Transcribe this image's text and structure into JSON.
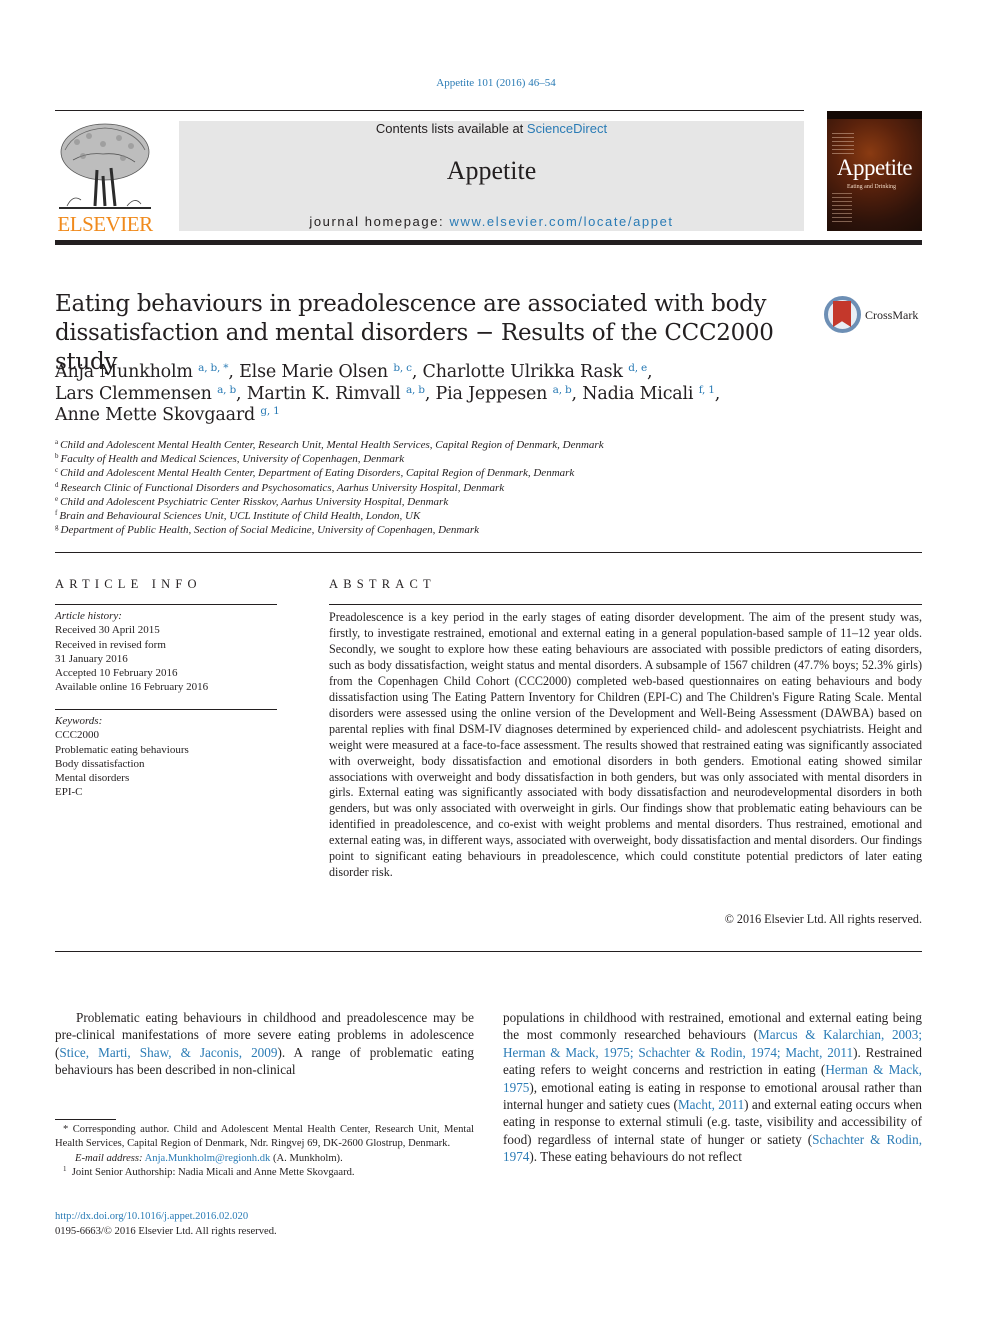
{
  "header": {
    "citation": "Appetite 101 (2016) 46–54",
    "contents_prefix": "Contents lists available at ",
    "contents_link": "ScienceDirect",
    "journal_name": "Appetite",
    "homepage_prefix": "journal homepage: ",
    "homepage_link": "www.elsevier.com/locate/appet",
    "publisher_logo_text": "ELSEVIER",
    "cover_title": "Appetite",
    "cover_subtitle": "Eating and Drinking",
    "crossmark_label": "CrossMark"
  },
  "article": {
    "title": "Eating behaviours in preadolescence are associated with body dissatisfaction and mental disorders − Results of the CCC2000 study",
    "authors": [
      {
        "name": "Anja Munkholm",
        "sup": "a, b, *",
        "sep": ", "
      },
      {
        "name": "Else Marie Olsen",
        "sup": "b, c",
        "sep": ", "
      },
      {
        "name": "Charlotte Ulrikka Rask",
        "sup": "d, e",
        "sep": ","
      },
      {
        "name": "Lars Clemmensen",
        "sup": "a, b",
        "sep": ", "
      },
      {
        "name": "Martin K. Rimvall",
        "sup": "a, b",
        "sep": ", "
      },
      {
        "name": "Pia Jeppesen",
        "sup": "a, b",
        "sep": ", "
      },
      {
        "name": "Nadia Micali",
        "sup": "f, 1",
        "sep": ","
      },
      {
        "name": "Anne Mette Skovgaard",
        "sup": "g, 1",
        "sep": ""
      }
    ],
    "affiliations": [
      {
        "key": "a",
        "text": "Child and Adolescent Mental Health Center, Research Unit, Mental Health Services, Capital Region of Denmark, Denmark"
      },
      {
        "key": "b",
        "text": "Faculty of Health and Medical Sciences, University of Copenhagen, Denmark"
      },
      {
        "key": "c",
        "text": "Child and Adolescent Mental Health Center, Department of Eating Disorders, Capital Region of Denmark, Denmark"
      },
      {
        "key": "d",
        "text": "Research Clinic of Functional Disorders and Psychosomatics, Aarhus University Hospital, Denmark"
      },
      {
        "key": "e",
        "text": "Child and Adolescent Psychiatric Center Risskov, Aarhus University Hospital, Denmark"
      },
      {
        "key": "f",
        "text": "Brain and Behavioural Sciences Unit, UCL Institute of Child Health, London, UK"
      },
      {
        "key": "g",
        "text": "Department of Public Health, Section of Social Medicine, University of Copenhagen, Denmark"
      }
    ]
  },
  "article_info": {
    "heading": "ARTICLE INFO",
    "history_label": "Article history:",
    "history": [
      "Received 30 April 2015",
      "Received in revised form",
      "31 January 2016",
      "Accepted 10 February 2016",
      "Available online 16 February 2016"
    ],
    "keywords_label": "Keywords:",
    "keywords": [
      "CCC2000",
      "Problematic eating behaviours",
      "Body dissatisfaction",
      "Mental disorders",
      "EPI-C"
    ]
  },
  "abstract": {
    "heading": "ABSTRACT",
    "text": "Preadolescence is a key period in the early stages of eating disorder development. The aim of the present study was, firstly, to investigate restrained, emotional and external eating in a general population-based sample of 11‒12 year olds. Secondly, we sought to explore how these eating behaviours are associated with possible predictors of eating disorders, such as body dissatisfaction, weight status and mental disorders. A subsample of 1567 children (47.7% boys; 52.3% girls) from the Copenhagen Child Cohort (CCC2000) completed web-based questionnaires on eating behaviours and body dissatisfaction using The Eating Pattern Inventory for Children (EPI-C) and The Children's Figure Rating Scale. Mental disor­ders were assessed using the online version of the Development and Well-Being Assessment (DAWBA) based on parental replies with final DSM-IV diagnoses determined by experienced child- and adolescent psychiatrists. Height and weight were measured at a face-to-face assessment. The results showed that restrained eating was significantly associated with overweight, body dissatisfaction and emotional dis­orders in both genders. Emotional eating showed similar associations with overweight and body dissatisfaction in both genders, but was only associated with mental disorders in girls. External eating was significantly associated with body dissatisfaction and neurodevelopmental disorders in both gen­ders, but was only associated with overweight in girls. Our findings show that problematic eating be­haviours can be identified in preadolescence, and co-exist with weight problems and mental disorders. Thus restrained, emotional and external eating was, in different ways, associated with overweight, body dissatisfaction and mental disorders. Our findings point to significant eating behaviours in preadoles­cence, which could constitute potential predictors of later eating disorder risk.",
    "copyright": "© 2016 Elsevier Ltd. All rights reserved."
  },
  "body": {
    "left": [
      {
        "t": "Problematic eating behaviours in childhood and preadolescence may be pre-clinical manifestations of more severe eating problems in adolescence (",
        "link": false
      },
      {
        "t": "Stice, Marti, Shaw, & Jaconis, 2009",
        "link": true
      },
      {
        "t": "). A range of problematic eating behaviours has been described in non-clinical",
        "link": false
      }
    ],
    "right": [
      {
        "t": "populations in childhood with restrained, emotional and external eating being the most commonly researched behaviours (",
        "link": false
      },
      {
        "t": "Marcus & Kalarchian, 2003; Herman & Mack, 1975; Schachter & Rodin, 1974; Macht, 2011",
        "link": true
      },
      {
        "t": "). Restrained eating refers to weight concerns and re­striction in eating (",
        "link": false
      },
      {
        "t": "Herman & Mack, 1975",
        "link": true
      },
      {
        "t": "), emotional eating is eating in response to emotional arousal rather than internal hunger and satiety cues (",
        "link": false
      },
      {
        "t": "Macht, 2011",
        "link": true
      },
      {
        "t": ") and external eating occurs when eating in response to external stimuli (e.g. taste, visibility and accessibility of food) regardless of internal state of hunger or satiety (",
        "link": false
      },
      {
        "t": "Schachter & Rodin, 1974",
        "link": true
      },
      {
        "t": "). These eating behaviours do not reflect",
        "link": false
      }
    ]
  },
  "footnotes": {
    "corresponding_mark": "*",
    "corresponding": "Corresponding author. Child and Adolescent Mental Health Center, Research Unit, Mental Health Services, Capital Region of Denmark, Ndr. Ringvej 69, DK-2600 Glostrup, Denmark.",
    "email_label": "E-mail address:",
    "email": "Anja.Munkholm@regionh.dk",
    "email_suffix": " (A. Munkholm).",
    "note1_mark": "1",
    "note1": "Joint Senior Authorship: Nadia Micali and Anne Mette Skovgaard.",
    "doi": "http://dx.doi.org/10.1016/j.appet.2016.02.020",
    "issn": "0195-6663/© 2016 Elsevier Ltd. All rights reserved."
  }
}
